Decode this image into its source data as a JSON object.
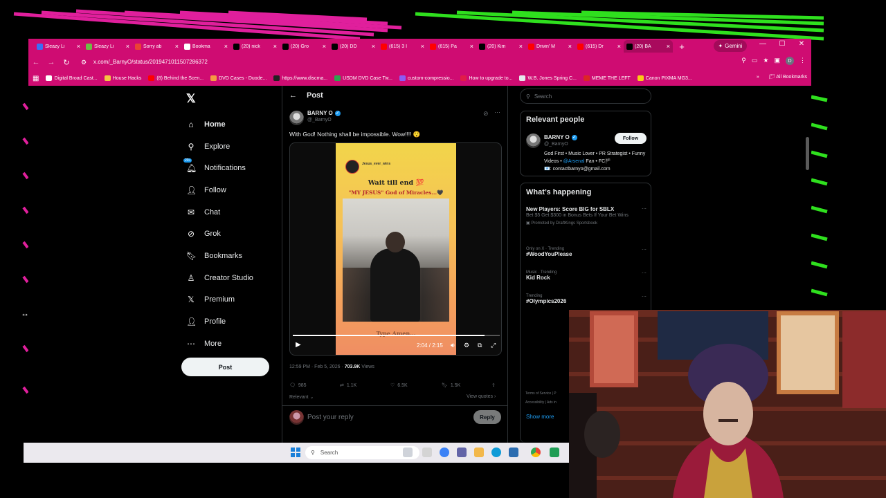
{
  "browser": {
    "tabs": [
      {
        "label": "Sleazy Li",
        "icon": "bluesky-icon",
        "color": "#3b6ff5"
      },
      {
        "label": "Sleazy Li",
        "icon": "rumble-icon",
        "color": "#6dbe44"
      },
      {
        "label": "Sorry ab",
        "icon": "gmail-icon",
        "color": "#ea4335"
      },
      {
        "label": "Bookma",
        "icon": "star-icon",
        "color": "#ffffff"
      },
      {
        "label": "(20) nick",
        "icon": "x-icon",
        "color": "#000000"
      },
      {
        "label": "(20) Gro",
        "icon": "x-icon",
        "color": "#000000"
      },
      {
        "label": "(20) DD",
        "icon": "x-icon",
        "color": "#000000"
      },
      {
        "label": "(615) 3 I",
        "icon": "youtube-icon",
        "color": "#ff0000"
      },
      {
        "label": "(615) Pa",
        "icon": "youtube-icon",
        "color": "#ff0000"
      },
      {
        "label": "(20) Kim",
        "icon": "x-icon",
        "color": "#000000"
      },
      {
        "label": "Drivin' M",
        "icon": "youtube-icon",
        "color": "#ff0000"
      },
      {
        "label": "(615) Dr",
        "icon": "youtube-icon",
        "color": "#ff0000"
      },
      {
        "label": "(20) BA",
        "icon": "x-icon",
        "color": "#000000",
        "active": true
      }
    ],
    "gemini_label": "Gemini",
    "url": "x.com/_BarnyO/status/2019471011507286372",
    "bookmarks": [
      {
        "label": "Digital Broad Cast...",
        "color": "#ffffff"
      },
      {
        "label": "House Hacks",
        "color": "#f5c542"
      },
      {
        "label": "(8) Behind the Scen...",
        "color": "#ff0000"
      },
      {
        "label": "DVD Cases - Duode...",
        "color": "#f59b42"
      },
      {
        "label": "https://www.discma...",
        "color": "#222222"
      },
      {
        "label": "USDM DVD Case Tw...",
        "color": "#2ea44f"
      },
      {
        "label": "custom-compressio...",
        "color": "#8b5cf6"
      },
      {
        "label": "How to upgrade to...",
        "color": "#e11d48"
      },
      {
        "label": "W.B. Jones Spring C...",
        "color": "#e5e7eb"
      },
      {
        "label": "MEME THE LEFT",
        "color": "#dc2626"
      },
      {
        "label": "Canon PIXMA MG3...",
        "color": "#facc15"
      }
    ],
    "all_bookmarks": "All Bookmarks",
    "profile_initial": "D"
  },
  "x": {
    "nav": [
      {
        "label": "Home",
        "icon": "home-icon",
        "glyph": "⌂",
        "bold": true
      },
      {
        "label": "Explore",
        "icon": "search-icon",
        "glyph": "⚲"
      },
      {
        "label": "Notifications",
        "icon": "bell-icon",
        "glyph": "🔔︎",
        "badge": "20+"
      },
      {
        "label": "Follow",
        "icon": "follow-icon",
        "glyph": "👤︎"
      },
      {
        "label": "Chat",
        "icon": "mail-icon",
        "glyph": "✉"
      },
      {
        "label": "Grok",
        "icon": "grok-icon",
        "glyph": "⊘"
      },
      {
        "label": "Bookmarks",
        "icon": "bookmark-icon",
        "glyph": "🔖︎"
      },
      {
        "label": "Creator Studio",
        "icon": "creator-studio-icon",
        "glyph": "♙"
      },
      {
        "label": "Premium",
        "icon": "x-premium-icon",
        "glyph": "𝕏"
      },
      {
        "label": "Profile",
        "icon": "profile-icon",
        "glyph": "👤︎"
      },
      {
        "label": "More",
        "icon": "more-icon",
        "glyph": "⋯"
      }
    ],
    "post_button": "Post",
    "header_title": "Post",
    "post": {
      "name": "BARNY O",
      "handle": "@_BarnyO",
      "text": "With God! Nothing shall be impossible.  Wow!!!! 😯",
      "video": {
        "channel": "Jesus_ever_wins",
        "title": "Wait till end 💯",
        "subtitle": "\"MY JESUS\" God of Miracles...🖤",
        "caption": "Type Amen...",
        "time": "2:04 / 2:15",
        "progress": 0.925
      },
      "timestamp": "12:59 PM · Feb 5, 2026 · ",
      "views_count": "703.9K",
      "views_label": " Views",
      "replies": "985",
      "reposts": "1.1K",
      "likes": "6.5K",
      "bookmarks": "1.5K",
      "relevant": "Relevant",
      "view_quotes": "View quotes",
      "reply_placeholder": "Post your reply",
      "reply_button": "Reply"
    },
    "search_placeholder": "Search",
    "relevant_people": {
      "title": "Relevant people",
      "name": "BARNY O",
      "handle": "@_BarnyO",
      "follow": "Follow",
      "bio_1": "God First • Music Lover • PR Strategist • Funny Videos • ",
      "bio_link": "@Arsenal",
      "bio_2": " Fan • FC🏴",
      "bio_3": "📧: contactbarnyo@gmail.com"
    },
    "whats_happening": {
      "title": "What’s happening",
      "items": [
        {
          "context": "",
          "title": "New Players: Score BIG for SBLX",
          "desc": "Bet $5 Get $300 in Bonus Bets If Your Bet Wins",
          "promo": "Promoted by DraftKings Sportsbook"
        },
        {
          "context": "Only on X · Trending",
          "title": "#WoodYouPlease"
        },
        {
          "context": "Music · Trending",
          "title": "Kid Rock"
        },
        {
          "context": "Trending",
          "title": "#Olympics2026"
        }
      ],
      "show_more": "Show more"
    },
    "footer": [
      "Terms of Service  |  P",
      "Accessibility  |  Ads in"
    ]
  },
  "taskbar": {
    "search": "Search"
  }
}
